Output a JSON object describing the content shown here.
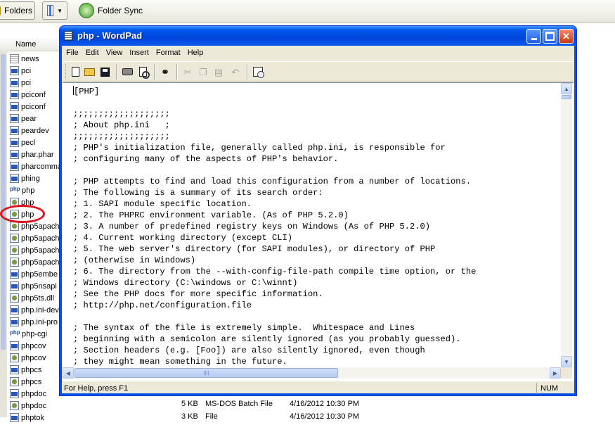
{
  "explorer": {
    "folders_label": "Folders",
    "sync_label": "Folder Sync",
    "name_header": "Name",
    "files": [
      {
        "name": "news",
        "icon": "txt"
      },
      {
        "name": "pci",
        "icon": "win"
      },
      {
        "name": "pci",
        "icon": "win"
      },
      {
        "name": "pciconf",
        "icon": "win"
      },
      {
        "name": "pciconf",
        "icon": "win"
      },
      {
        "name": "pear",
        "icon": "win"
      },
      {
        "name": "peardev",
        "icon": "win"
      },
      {
        "name": "pecl",
        "icon": "win"
      },
      {
        "name": "phar.phar",
        "icon": "win"
      },
      {
        "name": "pharcomma",
        "icon": "win"
      },
      {
        "name": "phing",
        "icon": "win"
      },
      {
        "name": "php",
        "icon": "php"
      },
      {
        "name": "php",
        "icon": "bat"
      },
      {
        "name": "php",
        "icon": "bat"
      },
      {
        "name": "php5apach",
        "icon": "bat"
      },
      {
        "name": "php5apach",
        "icon": "bat"
      },
      {
        "name": "php5apach",
        "icon": "bat"
      },
      {
        "name": "php5apach",
        "icon": "bat"
      },
      {
        "name": "php5embe",
        "icon": "win"
      },
      {
        "name": "php5nsapi",
        "icon": "win"
      },
      {
        "name": "php5ts.dll",
        "icon": "bat"
      },
      {
        "name": "php.ini-dev",
        "icon": "win"
      },
      {
        "name": "php.ini-pro",
        "icon": "win"
      },
      {
        "name": "php-cgi",
        "icon": "php"
      },
      {
        "name": "phpcov",
        "icon": "win"
      },
      {
        "name": "phpcov",
        "icon": "bat"
      },
      {
        "name": "phpcs",
        "icon": "win"
      },
      {
        "name": "phpcs",
        "icon": "bat"
      },
      {
        "name": "phpdoc",
        "icon": "win"
      },
      {
        "name": "phpdoc",
        "icon": "bat"
      },
      {
        "name": "phptok",
        "icon": "win"
      }
    ],
    "bottom_rows": [
      {
        "size": "5 KB",
        "type": "MS-DOS Batch File",
        "date": "4/16/2012 10:30 PM"
      },
      {
        "size": "3 KB",
        "type": "File",
        "date": "4/16/2012 10:30 PM"
      }
    ]
  },
  "wordpad": {
    "title": "php - WordPad",
    "menu": [
      "File",
      "Edit",
      "View",
      "Insert",
      "Format",
      "Help"
    ],
    "document_lines": [
      "[PHP]",
      "",
      ";;;;;;;;;;;;;;;;;;;",
      "; About php.ini   ;",
      ";;;;;;;;;;;;;;;;;;;",
      "; PHP's initialization file, generally called php.ini, is responsible for",
      "; configuring many of the aspects of PHP's behavior.",
      "",
      "; PHP attempts to find and load this configuration from a number of locations.",
      "; The following is a summary of its search order:",
      "; 1. SAPI module specific location.",
      "; 2. The PHPRC environment variable. (As of PHP 5.2.0)",
      "; 3. A number of predefined registry keys on Windows (As of PHP 5.2.0)",
      "; 4. Current working directory (except CLI)",
      "; 5. The web server's directory (for SAPI modules), or directory of PHP",
      "; (otherwise in Windows)",
      "; 6. The directory from the --with-config-file-path compile time option, or the",
      "; Windows directory (C:\\windows or C:\\winnt)",
      "; See the PHP docs for more specific information.",
      "; http://php.net/configuration.file",
      "",
      "; The syntax of the file is extremely simple.  Whitespace and Lines",
      "; beginning with a semicolon are silently ignored (as you probably guessed).",
      "; Section headers (e.g. [Foo]) are also silently ignored, even though",
      "; they might mean something in the future."
    ],
    "status_text": "For Help, press F1",
    "status_num": "NUM"
  }
}
